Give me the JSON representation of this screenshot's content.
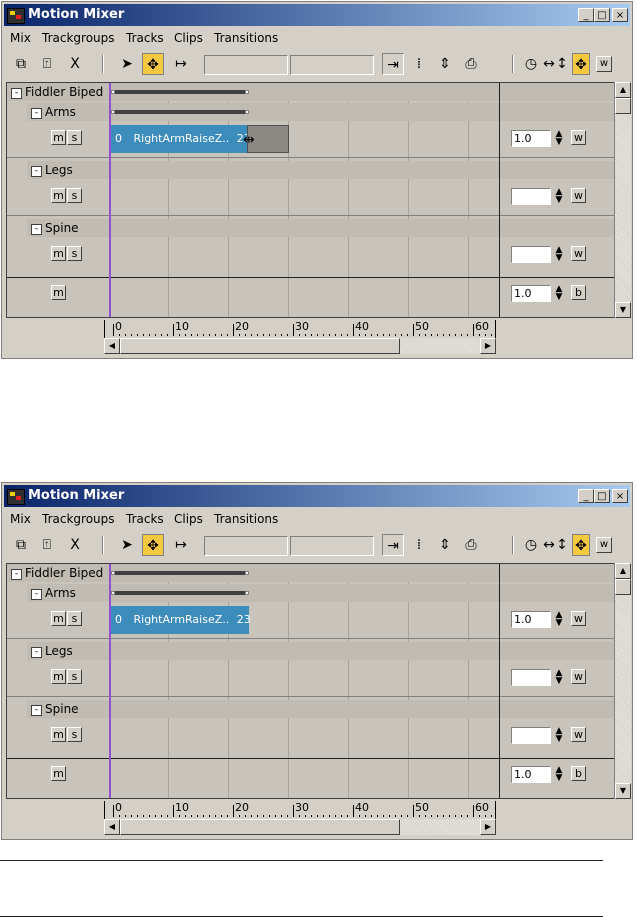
{
  "windows": [
    {
      "title": "Motion Mixer",
      "menu": [
        "Mix",
        "Trackgroups",
        "Tracks",
        "Clips",
        "Transitions"
      ],
      "window_buttons": {
        "minimize": "_",
        "maximize": "□",
        "close": "×"
      },
      "toolbar": {
        "delete_glyph": "X",
        "weight_label": "w"
      },
      "groups": [
        {
          "toggle": "-",
          "label": "Fiddler Biped"
        },
        {
          "toggle": "-",
          "label": "Arms",
          "m": "m",
          "s": "s",
          "weight": "1.0",
          "wbtn": "w"
        },
        {
          "toggle": "-",
          "label": "Legs",
          "m": "m",
          "s": "s",
          "weight": "",
          "wbtn": "w"
        },
        {
          "toggle": "-",
          "label": "Spine",
          "m": "m",
          "s": "s",
          "weight": "",
          "wbtn": "w"
        },
        {
          "m": "m",
          "weight": "1.0",
          "wbtn": "b"
        }
      ],
      "clip": {
        "start": "0",
        "name": "RightArmRaiseZ..",
        "end": "23",
        "dragging": true
      },
      "ruler_labels": [
        "0",
        "10",
        "20",
        "30",
        "40",
        "50",
        "60"
      ]
    },
    {
      "title": "Motion Mixer",
      "menu": [
        "Mix",
        "Trackgroups",
        "Tracks",
        "Clips",
        "Transitions"
      ],
      "window_buttons": {
        "minimize": "_",
        "maximize": "□",
        "close": "×"
      },
      "toolbar": {
        "delete_glyph": "X",
        "weight_label": "w"
      },
      "groups": [
        {
          "toggle": "-",
          "label": "Fiddler Biped"
        },
        {
          "toggle": "-",
          "label": "Arms",
          "m": "m",
          "s": "s",
          "weight": "1.0",
          "wbtn": "w"
        },
        {
          "toggle": "-",
          "label": "Legs",
          "m": "m",
          "s": "s",
          "weight": "",
          "wbtn": "w"
        },
        {
          "toggle": "-",
          "label": "Spine",
          "m": "m",
          "s": "s",
          "weight": "",
          "wbtn": "w"
        },
        {
          "m": "m",
          "weight": "1.0",
          "wbtn": "b"
        }
      ],
      "clip": {
        "start": "0",
        "name": "RightArmRaiseZ..",
        "end": "23",
        "dragging": false
      },
      "ruler_labels": [
        "0",
        "10",
        "20",
        "30",
        "40",
        "50",
        "60"
      ]
    }
  ],
  "colors": {
    "clip": "#3c8cbc",
    "playhead": "#9050d0",
    "active_tool": "#f5c842",
    "title_start": "#0a246a",
    "title_end": "#a6caf0"
  }
}
